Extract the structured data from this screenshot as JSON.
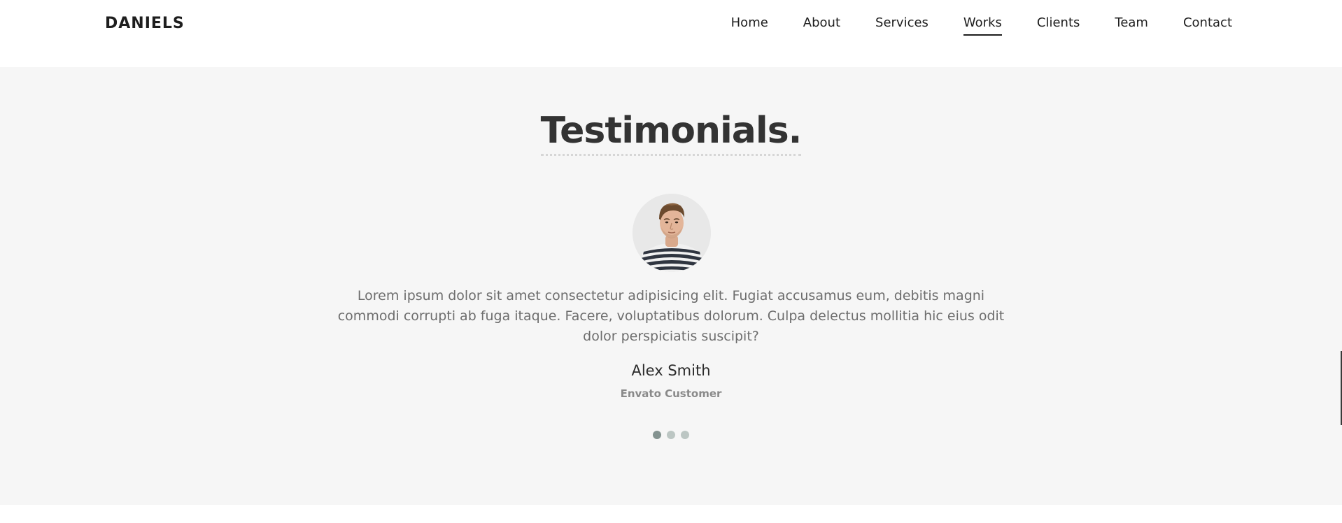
{
  "brand": "DANIELS",
  "nav": {
    "items": [
      {
        "label": "Home",
        "active": false
      },
      {
        "label": "About",
        "active": false
      },
      {
        "label": "Services",
        "active": false
      },
      {
        "label": "Works",
        "active": true
      },
      {
        "label": "Clients",
        "active": false
      },
      {
        "label": "Team",
        "active": false
      },
      {
        "label": "Contact",
        "active": false
      }
    ]
  },
  "testimonials": {
    "title": "Testimonials.",
    "quote": "Lorem ipsum dolor sit amet consectetur adipisicing elit. Fugiat accusamus eum, debitis magni commodi corrupti ab fuga itaque. Facere, voluptatibus dolorum. Culpa delectus mollitia hic eius odit dolor perspiciatis suscipit?",
    "name": "Alex Smith",
    "role": "Envato Customer",
    "slide_count": 3,
    "active_slide": 1
  },
  "colors": {
    "section_bg": "#f6f6f6",
    "dot_active": "#849390",
    "dot_inactive": "#bcc6c3"
  }
}
